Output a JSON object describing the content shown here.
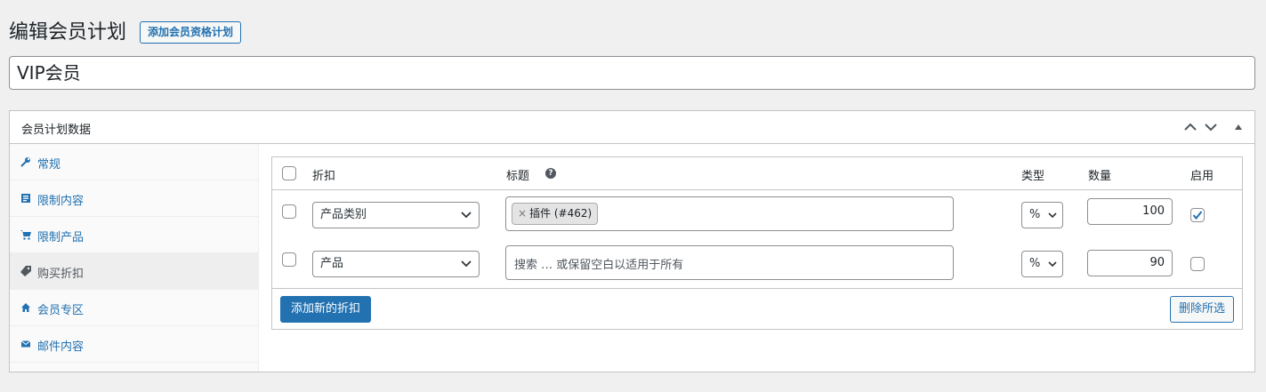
{
  "page": {
    "title": "编辑会员计划",
    "add_button": "添加会员资格计划",
    "plan_name": "VIP会员"
  },
  "metabox": {
    "title": "会员计划数据",
    "controls": [
      "move-up-icon",
      "move-down-icon",
      "toggle-panel-icon"
    ]
  },
  "sidebar": {
    "items": [
      {
        "label": "常规",
        "icon": "wrench-icon"
      },
      {
        "label": "限制内容",
        "icon": "document-icon"
      },
      {
        "label": "限制产品",
        "icon": "cart-icon"
      },
      {
        "label": "购买折扣",
        "icon": "tag-icon",
        "active": true
      },
      {
        "label": "会员专区",
        "icon": "home-icon"
      },
      {
        "label": "邮件内容",
        "icon": "email-icon"
      }
    ]
  },
  "table": {
    "headers": {
      "discount": "折扣",
      "title": "标题",
      "type": "类型",
      "amount": "数量",
      "enabled": "启用"
    },
    "rows": [
      {
        "discount_type": "产品类别",
        "tag": "插件 (#462)",
        "tag_remove": "×",
        "placeholder": "",
        "unit": "%",
        "amount": "100",
        "enabled": true
      },
      {
        "discount_type": "产品",
        "tag": "",
        "placeholder": "搜索 … 或保留空白以适用于所有",
        "unit": "%",
        "amount": "90",
        "enabled": false
      }
    ],
    "add_button": "添加新的折扣",
    "delete_button": "删除所选"
  },
  "colors": {
    "accent": "#2271b1",
    "background": "#f0f0f1"
  }
}
